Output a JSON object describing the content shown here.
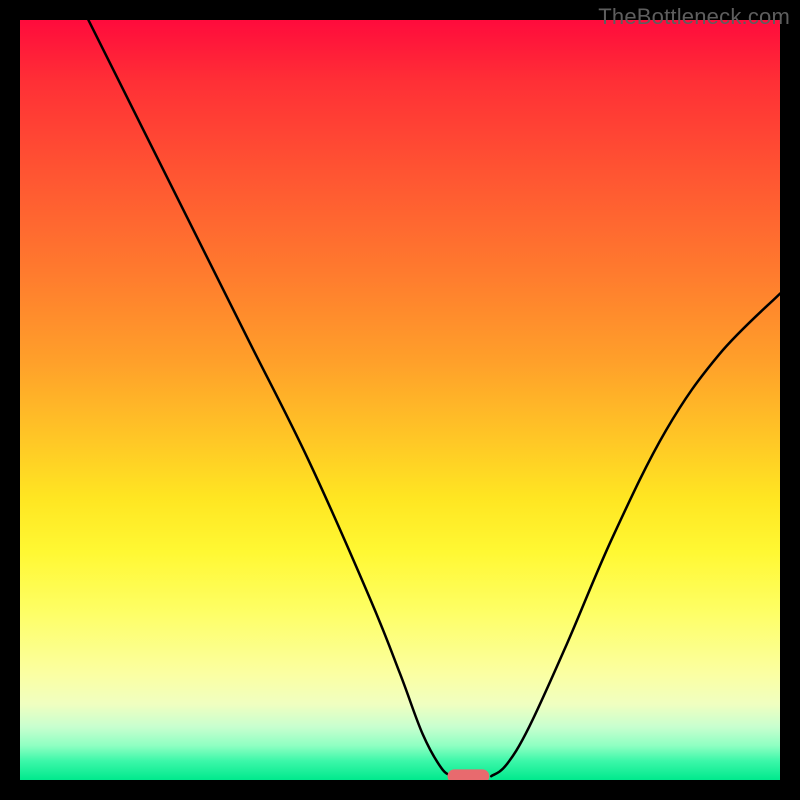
{
  "watermark": "TheBottleneck.com",
  "chart_data": {
    "type": "line",
    "title": "",
    "xlabel": "",
    "ylabel": "",
    "xlim": [
      0,
      100
    ],
    "ylim": [
      0,
      100
    ],
    "grid": false,
    "legend": false,
    "annotations": [],
    "watermark": "TheBottleneck.com",
    "background_gradient": {
      "direction": "vertical",
      "stops": [
        {
          "pos": 0.0,
          "color": "#ff0b3c"
        },
        {
          "pos": 0.08,
          "color": "#ff2f36"
        },
        {
          "pos": 0.2,
          "color": "#ff5432"
        },
        {
          "pos": 0.33,
          "color": "#ff7a2e"
        },
        {
          "pos": 0.45,
          "color": "#ffa02a"
        },
        {
          "pos": 0.55,
          "color": "#ffc626"
        },
        {
          "pos": 0.63,
          "color": "#ffe622"
        },
        {
          "pos": 0.7,
          "color": "#fff833"
        },
        {
          "pos": 0.78,
          "color": "#feff66"
        },
        {
          "pos": 0.86,
          "color": "#fbffa2"
        },
        {
          "pos": 0.9,
          "color": "#f0ffc0"
        },
        {
          "pos": 0.93,
          "color": "#c8ffcf"
        },
        {
          "pos": 0.955,
          "color": "#8effc2"
        },
        {
          "pos": 0.975,
          "color": "#3cf7a9"
        },
        {
          "pos": 1.0,
          "color": "#00e98d"
        }
      ]
    },
    "series": [
      {
        "name": "left-branch",
        "x": [
          9,
          15,
          22,
          30,
          38,
          46,
          50,
          53,
          55.5,
          57
        ],
        "y": [
          100,
          88,
          74,
          58,
          42,
          24,
          14,
          6,
          1.5,
          0.5
        ]
      },
      {
        "name": "right-branch",
        "x": [
          62,
          64,
          67,
          72,
          78,
          85,
          92,
          100
        ],
        "y": [
          0.5,
          2,
          7,
          18,
          32,
          46,
          56,
          64
        ]
      }
    ],
    "marker": {
      "shape": "rounded-rect",
      "x_center": 59,
      "y": 0.5,
      "width": 5.5,
      "height": 1.8,
      "color": "#e86a6e"
    }
  }
}
